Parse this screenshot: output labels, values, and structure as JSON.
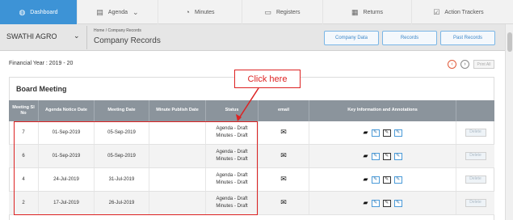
{
  "nav": {
    "items": [
      {
        "label": "Dashboard",
        "icon": "◍"
      },
      {
        "label": "Agenda",
        "icon": "▤",
        "has_dropdown": true
      },
      {
        "label": "Minutes",
        "icon": "◔"
      },
      {
        "label": "Registers",
        "icon": "▭"
      },
      {
        "label": "Returns",
        "icon": "▦"
      },
      {
        "label": "Action Trackers",
        "icon": "☑"
      }
    ],
    "active": "Dashboard",
    "accent": "#3d93d6"
  },
  "org": {
    "name": "SWATHI AGRO"
  },
  "breadcrumb": "Home  /  Company Records",
  "page_title": "Company Records",
  "tabs": [
    "Company Data",
    "Records",
    "Past Records"
  ],
  "financial_year": "Financial Year : 2019 - 20",
  "print_all": "Print All",
  "panel_title": "Board Meeting",
  "callout": "Click here",
  "table": {
    "headers": [
      "Meeting Sl No",
      "Agenda Notice Date",
      "Meeting Date",
      "Minute Publish Date",
      "Status",
      "email",
      "Key Information and Annotations",
      ""
    ],
    "rows": [
      {
        "sl": "7",
        "notice": "01-Sep-2019",
        "meeting": "05-Sep-2019",
        "publish": "",
        "status1": "Agenda - Draft",
        "status2": "Minutes - Draft",
        "delete": "Delete"
      },
      {
        "sl": "6",
        "notice": "01-Sep-2019",
        "meeting": "05-Sep-2019",
        "publish": "",
        "status1": "Agenda - Draft",
        "status2": "Minutes - Draft",
        "delete": "Delete"
      },
      {
        "sl": "4",
        "notice": "24-Jul-2019",
        "meeting": "31-Jul-2019",
        "publish": "",
        "status1": "Agenda - Draft",
        "status2": "Minutes - Draft",
        "delete": "Delete"
      },
      {
        "sl": "2",
        "notice": "17-Jul-2019",
        "meeting": "26-Jul-2019",
        "publish": "",
        "status1": "Agenda - Draft",
        "status2": "Minutes - Draft",
        "delete": "Delete"
      }
    ]
  },
  "icons": {
    "email": "✉",
    "comment": "▰",
    "note": "✎"
  }
}
